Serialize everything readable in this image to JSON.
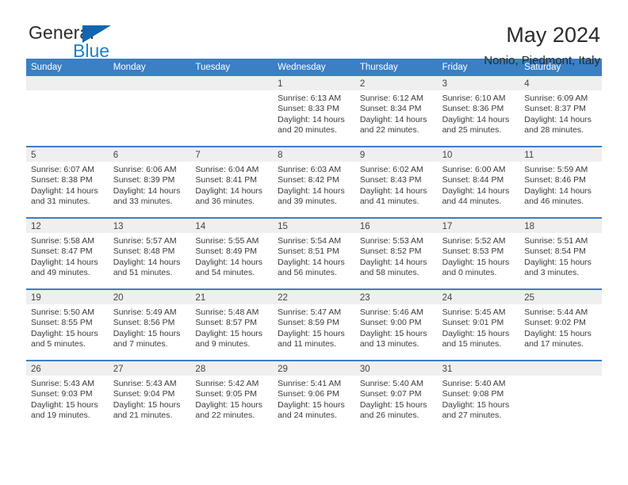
{
  "brand": {
    "word_one": "General",
    "word_two": "Blue",
    "triangle_icon": "triangle-icon",
    "accent_blue": "#1a7fd4",
    "logo_blue": "#1266b0"
  },
  "header": {
    "title": "May 2024",
    "subtitle": "Nonio, Piedmont, Italy"
  },
  "calendar": {
    "header_bg": "#3b7fc4",
    "daynum_band_bg": "#efefef",
    "weekdays": [
      "Sunday",
      "Monday",
      "Tuesday",
      "Wednesday",
      "Thursday",
      "Friday",
      "Saturday"
    ],
    "weeks": [
      [
        {
          "day": "",
          "empty": true
        },
        {
          "day": "",
          "empty": true
        },
        {
          "day": "",
          "empty": true
        },
        {
          "day": "1",
          "sunrise": "Sunrise: 6:13 AM",
          "sunset": "Sunset: 8:33 PM",
          "daylight1": "Daylight: 14 hours",
          "daylight2": "and 20 minutes."
        },
        {
          "day": "2",
          "sunrise": "Sunrise: 6:12 AM",
          "sunset": "Sunset: 8:34 PM",
          "daylight1": "Daylight: 14 hours",
          "daylight2": "and 22 minutes."
        },
        {
          "day": "3",
          "sunrise": "Sunrise: 6:10 AM",
          "sunset": "Sunset: 8:36 PM",
          "daylight1": "Daylight: 14 hours",
          "daylight2": "and 25 minutes."
        },
        {
          "day": "4",
          "sunrise": "Sunrise: 6:09 AM",
          "sunset": "Sunset: 8:37 PM",
          "daylight1": "Daylight: 14 hours",
          "daylight2": "and 28 minutes."
        }
      ],
      [
        {
          "day": "5",
          "sunrise": "Sunrise: 6:07 AM",
          "sunset": "Sunset: 8:38 PM",
          "daylight1": "Daylight: 14 hours",
          "daylight2": "and 31 minutes."
        },
        {
          "day": "6",
          "sunrise": "Sunrise: 6:06 AM",
          "sunset": "Sunset: 8:39 PM",
          "daylight1": "Daylight: 14 hours",
          "daylight2": "and 33 minutes."
        },
        {
          "day": "7",
          "sunrise": "Sunrise: 6:04 AM",
          "sunset": "Sunset: 8:41 PM",
          "daylight1": "Daylight: 14 hours",
          "daylight2": "and 36 minutes."
        },
        {
          "day": "8",
          "sunrise": "Sunrise: 6:03 AM",
          "sunset": "Sunset: 8:42 PM",
          "daylight1": "Daylight: 14 hours",
          "daylight2": "and 39 minutes."
        },
        {
          "day": "9",
          "sunrise": "Sunrise: 6:02 AM",
          "sunset": "Sunset: 8:43 PM",
          "daylight1": "Daylight: 14 hours",
          "daylight2": "and 41 minutes."
        },
        {
          "day": "10",
          "sunrise": "Sunrise: 6:00 AM",
          "sunset": "Sunset: 8:44 PM",
          "daylight1": "Daylight: 14 hours",
          "daylight2": "and 44 minutes."
        },
        {
          "day": "11",
          "sunrise": "Sunrise: 5:59 AM",
          "sunset": "Sunset: 8:46 PM",
          "daylight1": "Daylight: 14 hours",
          "daylight2": "and 46 minutes."
        }
      ],
      [
        {
          "day": "12",
          "sunrise": "Sunrise: 5:58 AM",
          "sunset": "Sunset: 8:47 PM",
          "daylight1": "Daylight: 14 hours",
          "daylight2": "and 49 minutes."
        },
        {
          "day": "13",
          "sunrise": "Sunrise: 5:57 AM",
          "sunset": "Sunset: 8:48 PM",
          "daylight1": "Daylight: 14 hours",
          "daylight2": "and 51 minutes."
        },
        {
          "day": "14",
          "sunrise": "Sunrise: 5:55 AM",
          "sunset": "Sunset: 8:49 PM",
          "daylight1": "Daylight: 14 hours",
          "daylight2": "and 54 minutes."
        },
        {
          "day": "15",
          "sunrise": "Sunrise: 5:54 AM",
          "sunset": "Sunset: 8:51 PM",
          "daylight1": "Daylight: 14 hours",
          "daylight2": "and 56 minutes."
        },
        {
          "day": "16",
          "sunrise": "Sunrise: 5:53 AM",
          "sunset": "Sunset: 8:52 PM",
          "daylight1": "Daylight: 14 hours",
          "daylight2": "and 58 minutes."
        },
        {
          "day": "17",
          "sunrise": "Sunrise: 5:52 AM",
          "sunset": "Sunset: 8:53 PM",
          "daylight1": "Daylight: 15 hours",
          "daylight2": "and 0 minutes."
        },
        {
          "day": "18",
          "sunrise": "Sunrise: 5:51 AM",
          "sunset": "Sunset: 8:54 PM",
          "daylight1": "Daylight: 15 hours",
          "daylight2": "and 3 minutes."
        }
      ],
      [
        {
          "day": "19",
          "sunrise": "Sunrise: 5:50 AM",
          "sunset": "Sunset: 8:55 PM",
          "daylight1": "Daylight: 15 hours",
          "daylight2": "and 5 minutes."
        },
        {
          "day": "20",
          "sunrise": "Sunrise: 5:49 AM",
          "sunset": "Sunset: 8:56 PM",
          "daylight1": "Daylight: 15 hours",
          "daylight2": "and 7 minutes."
        },
        {
          "day": "21",
          "sunrise": "Sunrise: 5:48 AM",
          "sunset": "Sunset: 8:57 PM",
          "daylight1": "Daylight: 15 hours",
          "daylight2": "and 9 minutes."
        },
        {
          "day": "22",
          "sunrise": "Sunrise: 5:47 AM",
          "sunset": "Sunset: 8:59 PM",
          "daylight1": "Daylight: 15 hours",
          "daylight2": "and 11 minutes."
        },
        {
          "day": "23",
          "sunrise": "Sunrise: 5:46 AM",
          "sunset": "Sunset: 9:00 PM",
          "daylight1": "Daylight: 15 hours",
          "daylight2": "and 13 minutes."
        },
        {
          "day": "24",
          "sunrise": "Sunrise: 5:45 AM",
          "sunset": "Sunset: 9:01 PM",
          "daylight1": "Daylight: 15 hours",
          "daylight2": "and 15 minutes."
        },
        {
          "day": "25",
          "sunrise": "Sunrise: 5:44 AM",
          "sunset": "Sunset: 9:02 PM",
          "daylight1": "Daylight: 15 hours",
          "daylight2": "and 17 minutes."
        }
      ],
      [
        {
          "day": "26",
          "sunrise": "Sunrise: 5:43 AM",
          "sunset": "Sunset: 9:03 PM",
          "daylight1": "Daylight: 15 hours",
          "daylight2": "and 19 minutes."
        },
        {
          "day": "27",
          "sunrise": "Sunrise: 5:43 AM",
          "sunset": "Sunset: 9:04 PM",
          "daylight1": "Daylight: 15 hours",
          "daylight2": "and 21 minutes."
        },
        {
          "day": "28",
          "sunrise": "Sunrise: 5:42 AM",
          "sunset": "Sunset: 9:05 PM",
          "daylight1": "Daylight: 15 hours",
          "daylight2": "and 22 minutes."
        },
        {
          "day": "29",
          "sunrise": "Sunrise: 5:41 AM",
          "sunset": "Sunset: 9:06 PM",
          "daylight1": "Daylight: 15 hours",
          "daylight2": "and 24 minutes."
        },
        {
          "day": "30",
          "sunrise": "Sunrise: 5:40 AM",
          "sunset": "Sunset: 9:07 PM",
          "daylight1": "Daylight: 15 hours",
          "daylight2": "and 26 minutes."
        },
        {
          "day": "31",
          "sunrise": "Sunrise: 5:40 AM",
          "sunset": "Sunset: 9:08 PM",
          "daylight1": "Daylight: 15 hours",
          "daylight2": "and 27 minutes."
        },
        {
          "day": "",
          "empty": true
        }
      ]
    ]
  }
}
